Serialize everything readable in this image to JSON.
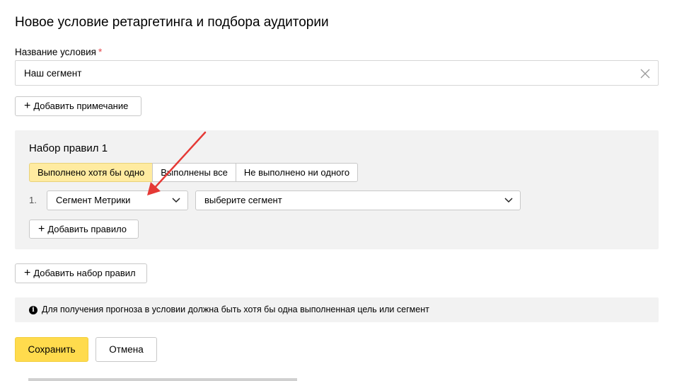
{
  "page": {
    "title": "Новое условие ретаргетинга и подбора аудитории"
  },
  "condition_name": {
    "label": "Название условия",
    "required_mark": "*",
    "value": "Наш сегмент"
  },
  "add_note_label": "Добавить примечание",
  "ruleset": {
    "title": "Набор правил 1",
    "modes": [
      {
        "label": "Выполнено хотя бы одно",
        "active": true
      },
      {
        "label": "Выполнены все",
        "active": false
      },
      {
        "label": "Не выполнено ни одного",
        "active": false
      }
    ],
    "rule": {
      "number": "1.",
      "type_value": "Сегмент Метрики",
      "segment_placeholder": "выберите сегмент"
    },
    "add_rule_label": "Добавить правило"
  },
  "add_ruleset_label": "Добавить набор правил",
  "info_text": "Для получения прогноза в условии должна быть хотя бы одна выполненная цель или сегмент",
  "actions": {
    "save_label": "Сохранить",
    "cancel_label": "Отмена"
  },
  "colors": {
    "accent_yellow": "#ffdb4d",
    "active_segment": "#ffeba0",
    "panel_bg": "#f2f2f2",
    "annotation_arrow": "#e53935",
    "required_mark": "#e5484d"
  }
}
